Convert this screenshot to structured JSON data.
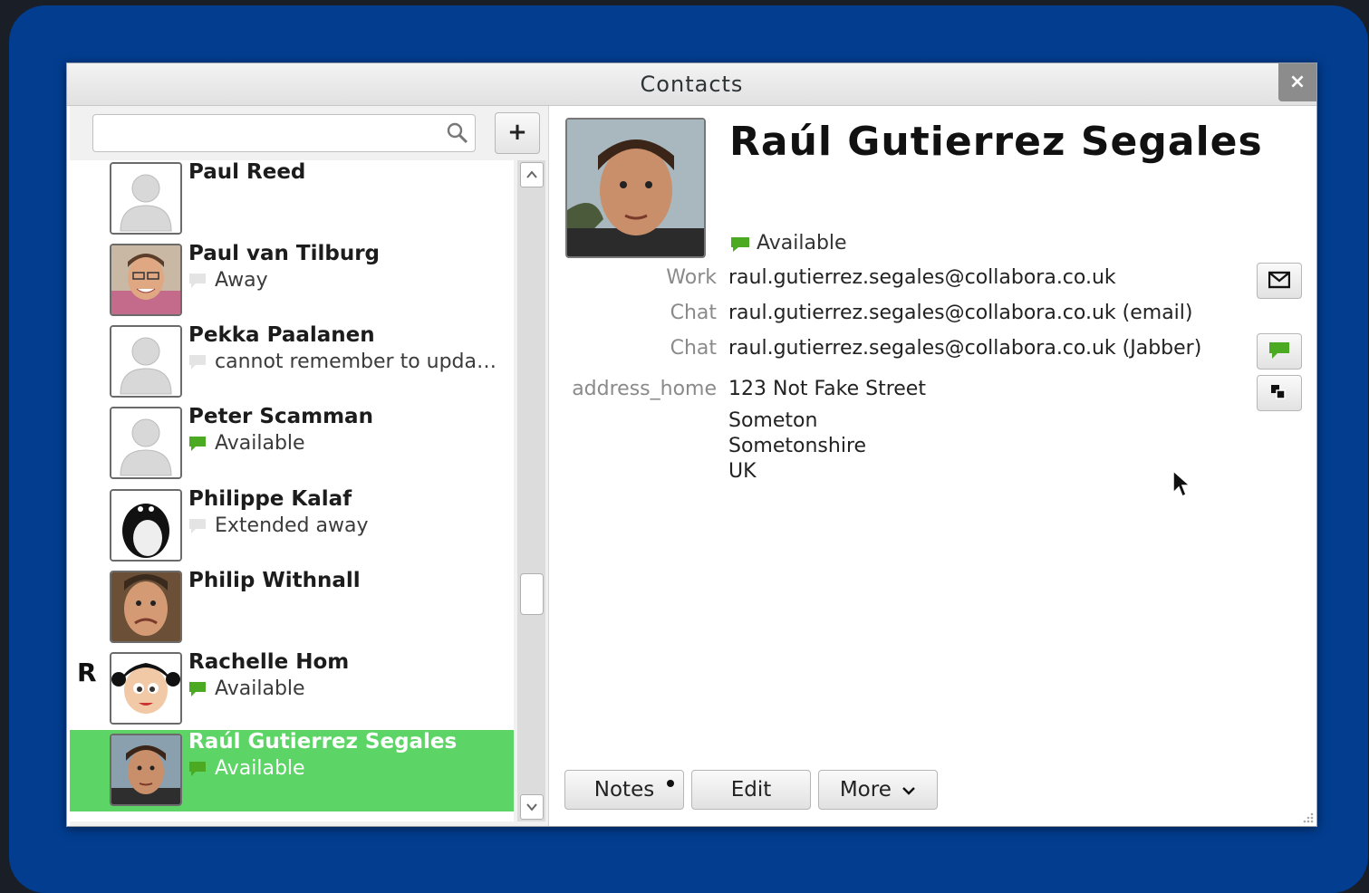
{
  "window": {
    "title": "Contacts",
    "close_label": "×"
  },
  "search": {
    "placeholder": "",
    "add_label": "+"
  },
  "group_letter": "R",
  "contacts": [
    {
      "name": "Paul Reed",
      "status": "",
      "status_kind": "none",
      "avatar": "default-avatar"
    },
    {
      "name": "Paul van Tilburg",
      "status": "Away",
      "status_kind": "away",
      "avatar": "photo-avatar"
    },
    {
      "name": "Pekka Paalanen",
      "status": "cannot remember to upda…",
      "status_kind": "away",
      "avatar": "default-avatar"
    },
    {
      "name": "Peter Scamman",
      "status": "Available",
      "status_kind": "available",
      "avatar": "default-avatar"
    },
    {
      "name": "Philippe Kalaf",
      "status": "Extended away",
      "status_kind": "away",
      "avatar": "penguin-avatar"
    },
    {
      "name": "Philip Withnall",
      "status": "",
      "status_kind": "none",
      "avatar": "photo-avatar"
    },
    {
      "name": "Rachelle Hom",
      "status": "Available",
      "status_kind": "available",
      "avatar": "cartoon-avatar"
    },
    {
      "name": "Raúl Gutierrez Segales",
      "status": "Available",
      "status_kind": "available",
      "avatar": "photo-avatar"
    }
  ],
  "detail": {
    "name": "Raúl Gutierrez Segales",
    "presence": "Available",
    "fields": [
      {
        "label": "Work",
        "value": "raul.gutierrez.segales@collabora.co.uk"
      },
      {
        "label": "Chat",
        "value": "raul.gutierrez.segales@collabora.co.uk (email)"
      },
      {
        "label": "Chat",
        "value": "raul.gutierrez.segales@collabora.co.uk (Jabber)"
      },
      {
        "label": "address_home",
        "value": "123 Not Fake Street"
      }
    ],
    "address_lines": [
      "Someton",
      "Sometonshire",
      "UK"
    ]
  },
  "buttons": {
    "notes": "Notes",
    "edit": "Edit",
    "more": "More"
  },
  "colors": {
    "desktop": "#023d8f",
    "selected": "#5cd466",
    "available": "#4caa22"
  },
  "icons": [
    "search-icon",
    "plus-icon",
    "close-icon",
    "email-icon",
    "chat-icon",
    "copy-icon",
    "chevron-down-icon"
  ]
}
